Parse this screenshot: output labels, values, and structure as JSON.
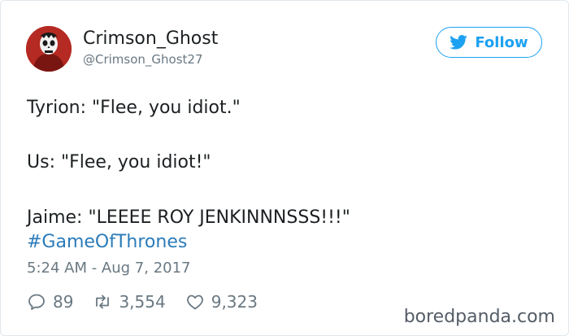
{
  "user": {
    "name": "Crimson_Ghost",
    "handle": "@Crimson_Ghost27"
  },
  "follow_button": {
    "label": "Follow"
  },
  "tweet": {
    "lines": [
      "Tyrion: \"Flee, you idiot.\"",
      "Us: \"Flee, you idiot!\"",
      "Jaime: \"LEEEE ROY JENKINNNSSS!!!\""
    ],
    "hashtag": "#GameOfThrones",
    "timestamp": "5:24 AM - Aug 7, 2017"
  },
  "actions": {
    "replies": "89",
    "retweets": "3,554",
    "likes": "9,323"
  },
  "watermark": "boredpanda.com",
  "colors": {
    "accent": "#1da1f2",
    "hashtag": "#2b7bb9",
    "muted": "#697882"
  },
  "icons": [
    "twitter-bird-icon",
    "reply-icon",
    "retweet-icon",
    "heart-icon"
  ]
}
